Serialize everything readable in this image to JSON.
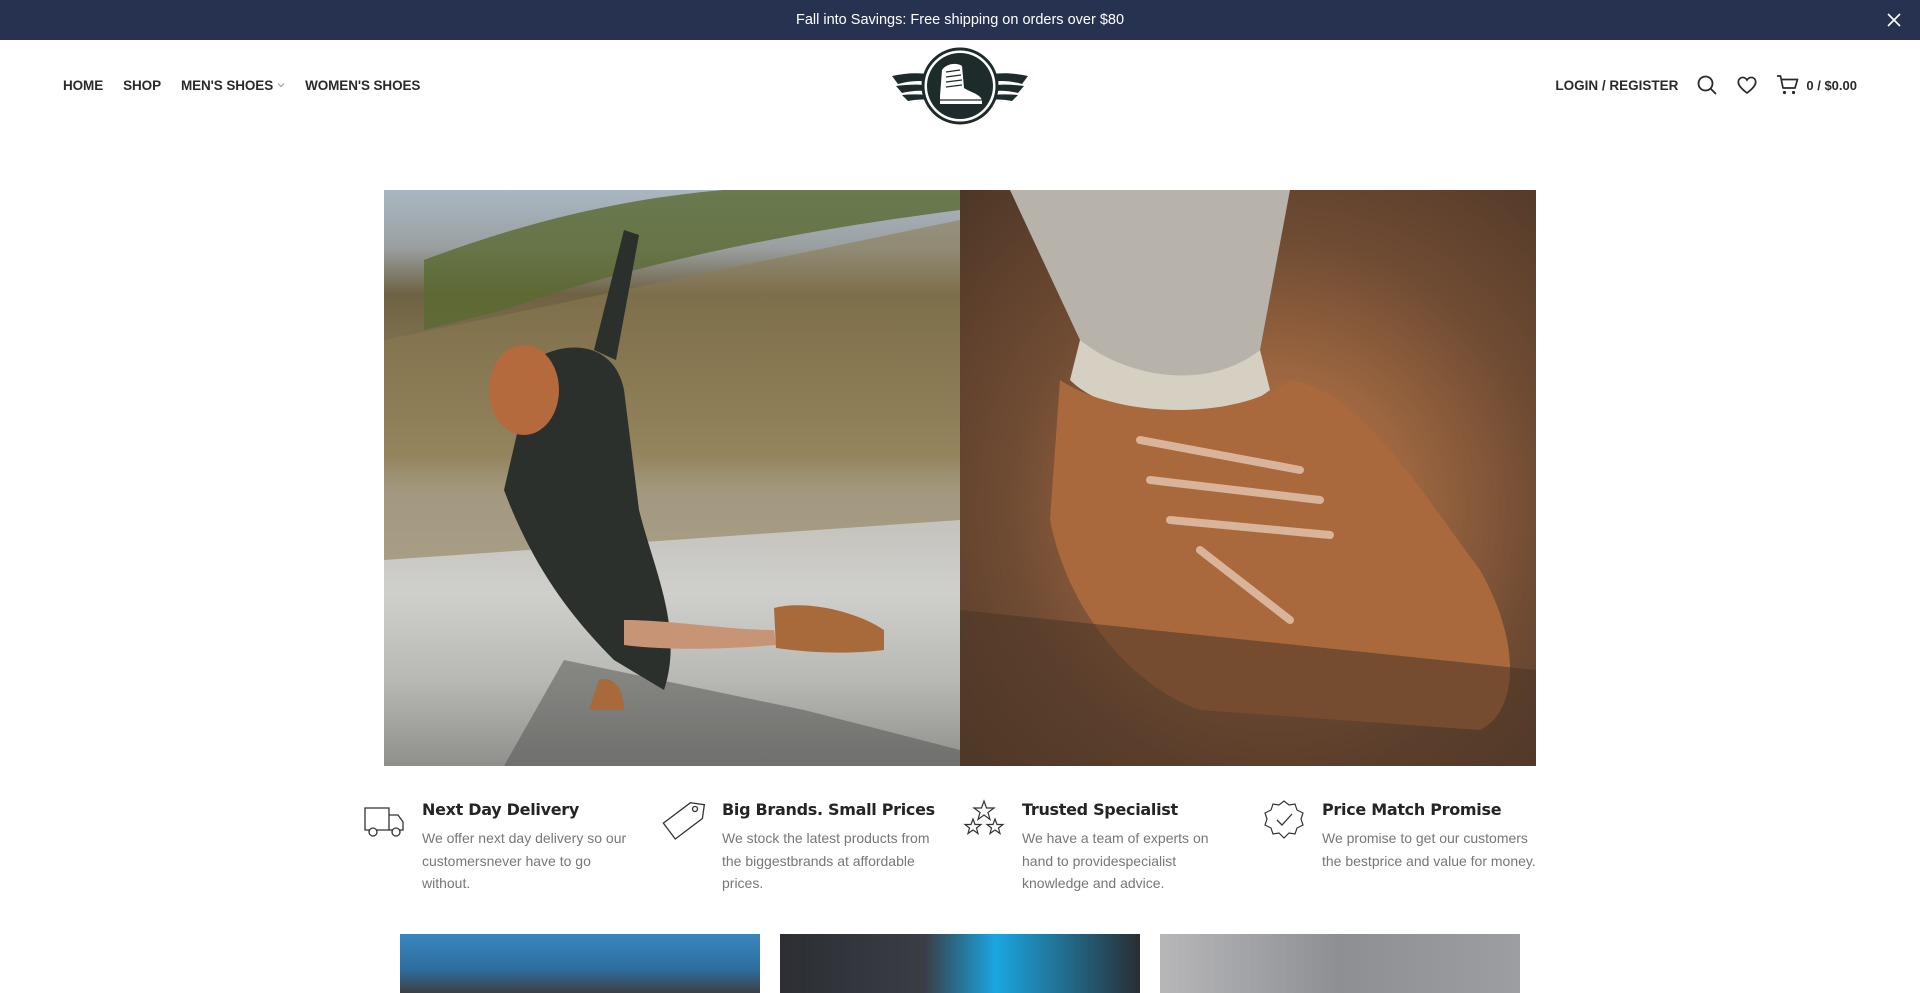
{
  "promo": {
    "text": "Fall into Savings: Free shipping on orders over $80",
    "close_icon": "close-icon"
  },
  "nav": {
    "items": [
      {
        "label": "HOME",
        "has_dropdown": false
      },
      {
        "label": "SHOP",
        "has_dropdown": false
      },
      {
        "label": "MEN'S SHOES",
        "has_dropdown": true
      },
      {
        "label": "WOMEN'S SHOES",
        "has_dropdown": false
      }
    ]
  },
  "header": {
    "login_label": "LOGIN / REGISTER",
    "search_icon": "search-icon",
    "wishlist_icon": "heart-icon",
    "cart_icon": "cart-icon",
    "cart_text": "0 / $0.00"
  },
  "features": [
    {
      "icon": "truck-icon",
      "title": "Next Day Delivery",
      "desc": "We offer next day delivery so our customersnever have to go without."
    },
    {
      "icon": "tag-icon",
      "title": "Big Brands. Small Prices",
      "desc": "We stock the latest products from the biggestbrands at affordable prices."
    },
    {
      "icon": "stars-icon",
      "title": "Trusted Specialist",
      "desc": "We have a team of experts on hand to providespecialist knowledge and advice."
    },
    {
      "icon": "badge-check-icon",
      "title": "Price Match Promise",
      "desc": "We promise to get our customers the bestprice and value for money."
    }
  ],
  "colors": {
    "promo_bg": "#26324f",
    "text_dark": "#242424",
    "text_muted": "#777777"
  }
}
